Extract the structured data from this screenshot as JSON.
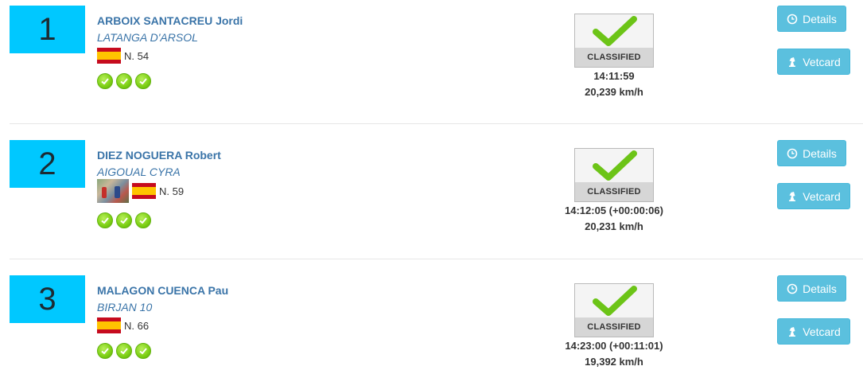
{
  "status_label": "CLASSIFIED",
  "details_label": "Details",
  "vetcard_label": "Vetcard",
  "colors": {
    "rank_bg": "#00c8ff",
    "link": "#3a74a8",
    "button": "#5bc0de",
    "check": "#7ccf14"
  },
  "results": [
    {
      "rank": "1",
      "rider": "ARBOIX SANTACREU Jordi",
      "horse": "LATANGA D'ARSOL",
      "bib": "N. 54",
      "time": "14:11:59",
      "speed": "20,239 km/h",
      "checks": 3
    },
    {
      "rank": "2",
      "rider": "DIEZ NOGUERA Robert",
      "horse": "AIGOUAL CYRA",
      "bib": "N. 59",
      "time": "14:12:05 (+00:00:06)",
      "speed": "20,231 km/h",
      "checks": 3
    },
    {
      "rank": "3",
      "rider": "MALAGON CUENCA Pau",
      "horse": "BIRJAN 10",
      "bib": "N. 66",
      "time": "14:23:00 (+00:11:01)",
      "speed": "19,392 km/h",
      "checks": 3
    }
  ]
}
